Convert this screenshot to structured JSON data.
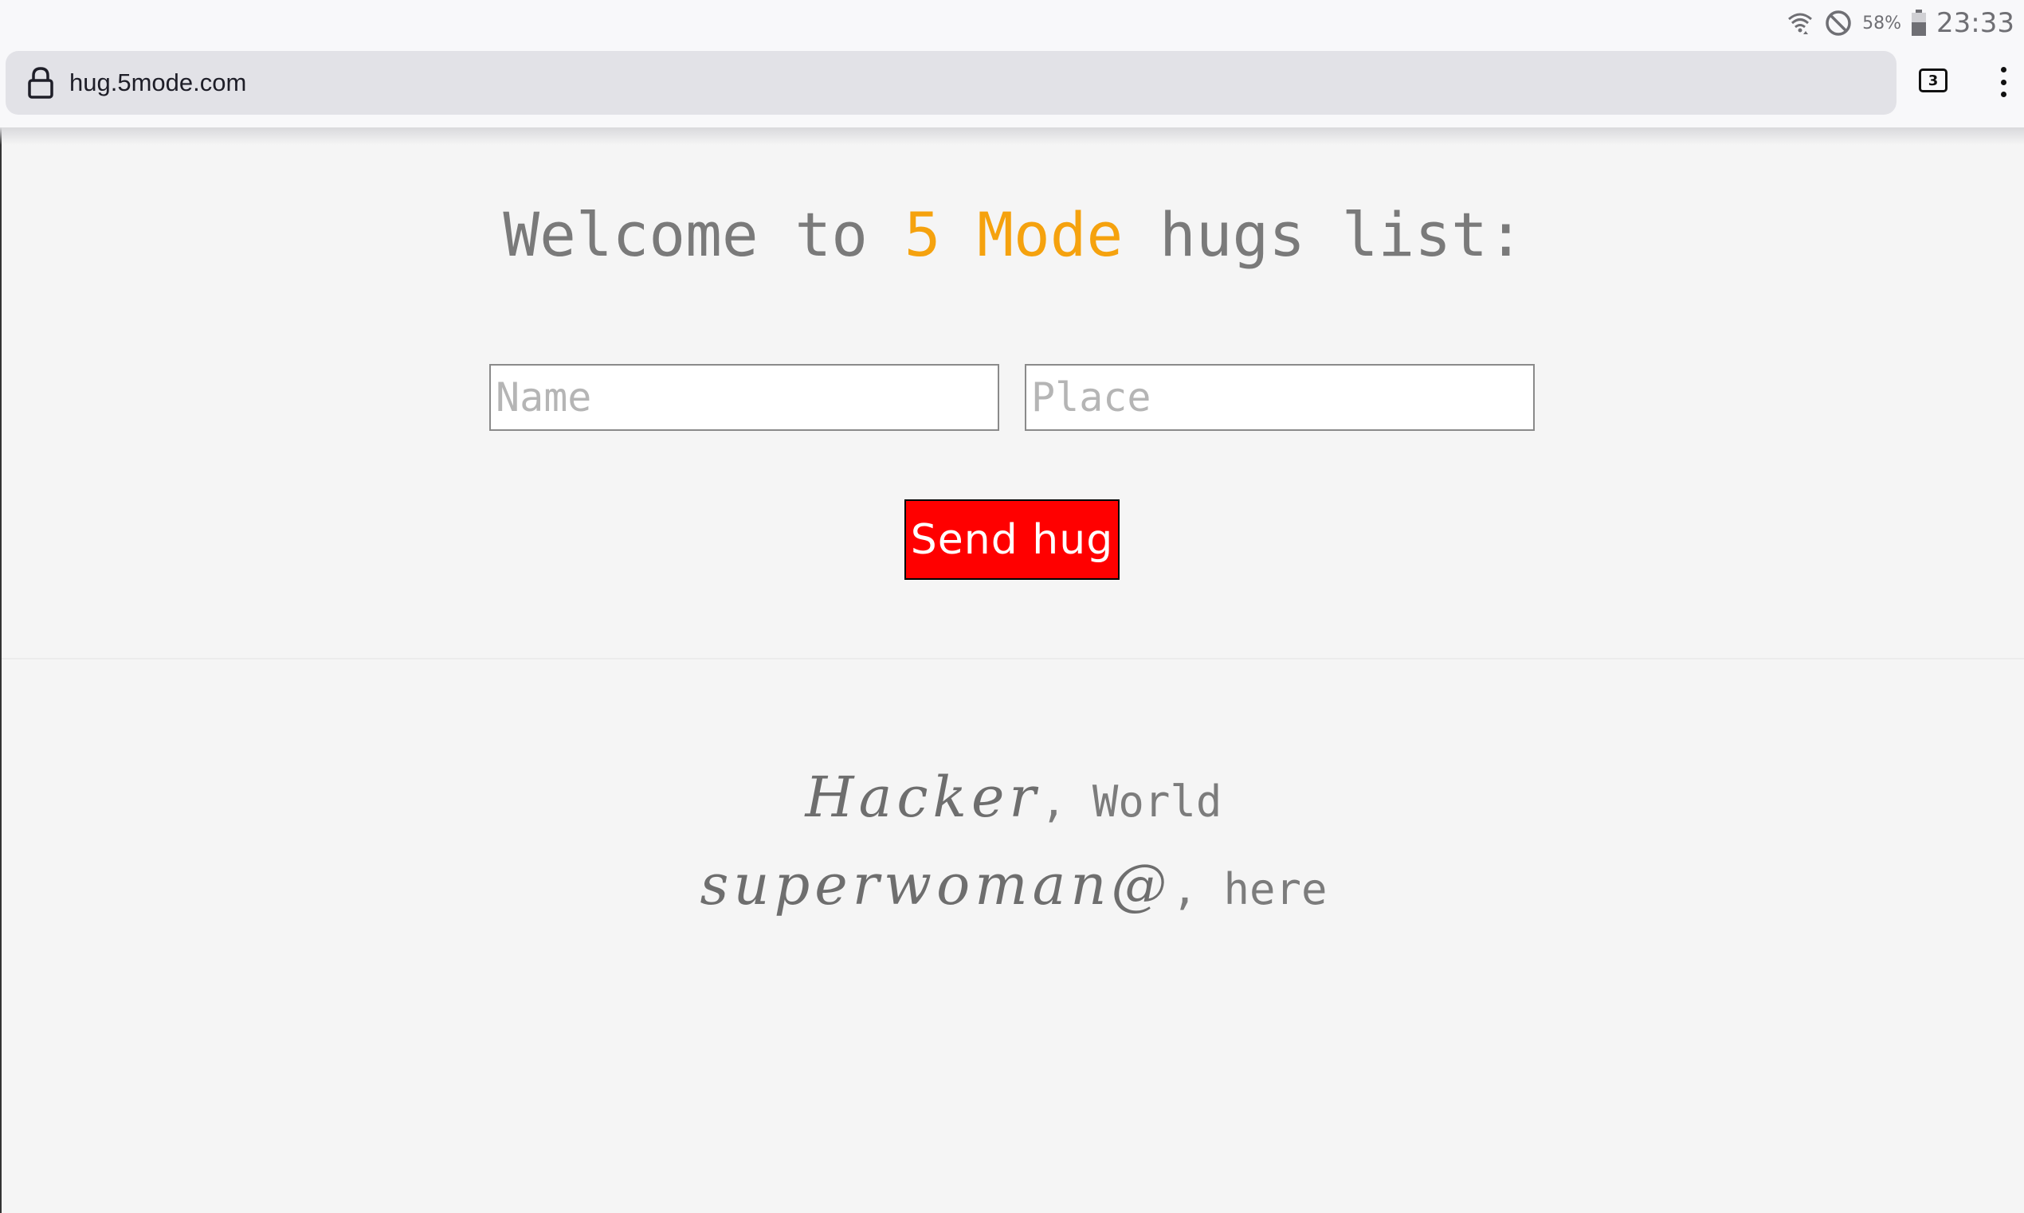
{
  "status_bar": {
    "battery_percent": "58%",
    "time": "23:33",
    "icons": [
      "wifi-icon",
      "do-not-disturb-icon",
      "battery-icon"
    ]
  },
  "browser": {
    "url": "hug.5mode.com",
    "tab_count": "3",
    "icons": [
      "lock-icon",
      "tabs-icon",
      "more-menu-icon"
    ]
  },
  "page": {
    "heading_prefix": "Welcome to ",
    "heading_brand": "5 Mode",
    "heading_suffix": " hugs list:",
    "brand_color": "#f5a20e",
    "name_placeholder": "Name",
    "place_placeholder": "Place",
    "send_button_label": "Send hug",
    "send_button_color": "#ff0000",
    "hugs": [
      {
        "name": "Hacker",
        "separator": ", ",
        "place": "World"
      },
      {
        "name": "superwoman@",
        "separator": ", ",
        "place": "here"
      }
    ]
  }
}
